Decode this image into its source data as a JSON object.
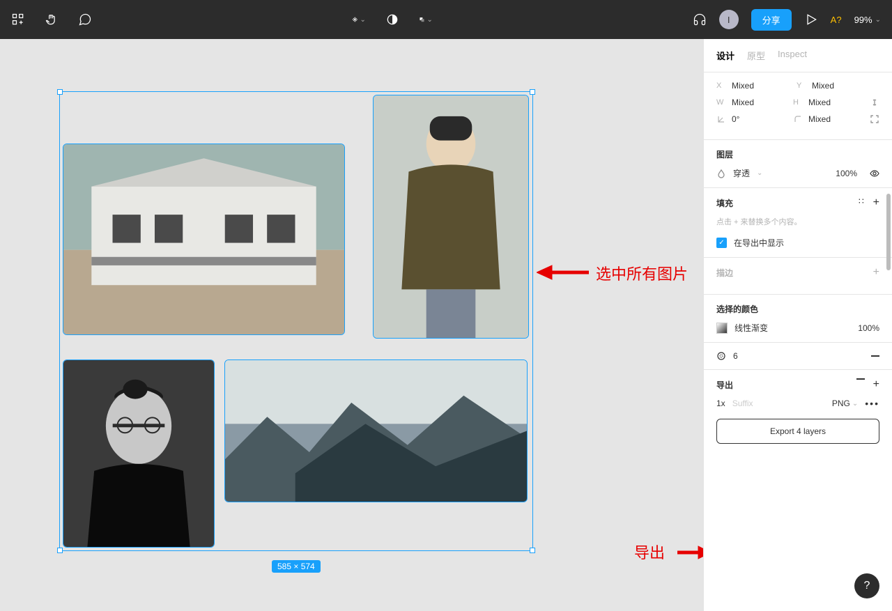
{
  "toolbar": {
    "avatar_initial": "I",
    "share_label": "分享",
    "a_badge": "A?",
    "zoom": "99%"
  },
  "canvas": {
    "dimensions": "585 × 574"
  },
  "annotations": {
    "select_all": "选中所有图片",
    "export_label": "导出"
  },
  "panel": {
    "tabs": {
      "design": "设计",
      "prototype": "原型",
      "inspect": "Inspect"
    },
    "props": {
      "x_label": "X",
      "x_val": "Mixed",
      "y_label": "Y",
      "y_val": "Mixed",
      "w_label": "W",
      "w_val": "Mixed",
      "h_label": "H",
      "h_val": "Mixed",
      "r_val": "0°",
      "corner_val": "Mixed"
    },
    "layer": {
      "title": "图层",
      "blend": "穿透",
      "opacity": "100%"
    },
    "fill": {
      "title": "填充",
      "hint": "点击 + 来替换多个内容。",
      "checkbox": "在导出中显示"
    },
    "stroke": {
      "title": "描边"
    },
    "selection_colors": {
      "title": "选择的颜色",
      "type": "线性渐变",
      "opacity": "100%"
    },
    "effects_count": "6",
    "export": {
      "title": "导出",
      "scale": "1x",
      "suffix_placeholder": "Suffix",
      "format": "PNG",
      "button": "Export 4 layers"
    }
  }
}
